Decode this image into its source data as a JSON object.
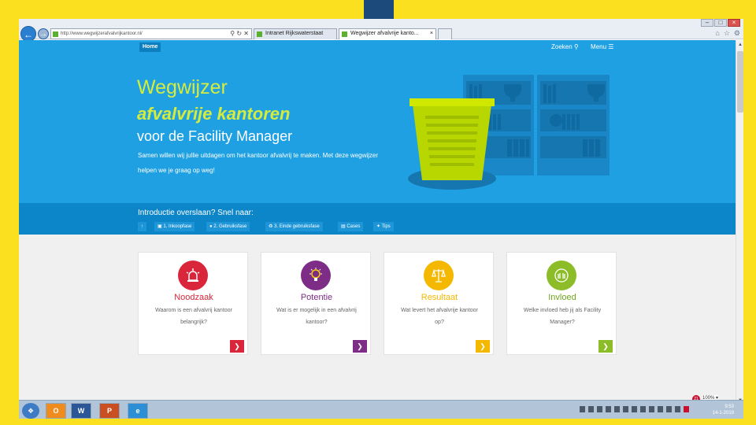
{
  "browser": {
    "address": "http://www.wegwijzerafvalvrijkantoor.nl/",
    "tabs": [
      {
        "label": "Intranet Rijkswaterstaat"
      },
      {
        "label": "Wegwijzer afvalvrije kanto..."
      }
    ],
    "window_controls": [
      "–",
      "□",
      "×"
    ],
    "zoom_label": "100%"
  },
  "site": {
    "nav": {
      "home": "Home",
      "search": "Zoeken",
      "menu": "Menu"
    },
    "hero": {
      "title_line1": "Wegwijzer",
      "title_line2": "afvalvrije kantoren",
      "title_line3": "voor de Facility Manager",
      "description": "Samen willen wij jullie uitdagen om het kantoor afvalvrij te maken. Met deze wegwijzer helpen we je graag op weg!"
    },
    "quickbar": {
      "question": "Introductie overslaan? Snel naar:",
      "links": [
        {
          "label": "1. Inkoopfase"
        },
        {
          "label": "2. Gebruiksfase"
        },
        {
          "label": "3. Einde gebruiksfase"
        },
        {
          "label": "Cases"
        },
        {
          "label": "Tips"
        }
      ]
    },
    "cards": [
      {
        "title": "Noodzaak",
        "description": "Waarom is een afvalvrij kantoor belangrijk?",
        "color": "#d9263a",
        "icon": "siren-icon"
      },
      {
        "title": "Potentie",
        "description": "Wat is er mogelijk in een afvalvrij kantoor?",
        "color": "#7e2d86",
        "icon": "lightbulb-icon"
      },
      {
        "title": "Resultaat",
        "description": "Wat levert het afvalvrije kantoor op?",
        "color": "#f5b800",
        "icon": "scales-icon"
      },
      {
        "title": "Invloed",
        "description": "Welke invloed heb jij als Facility Manager?",
        "color": "#8cbd28",
        "icon": "hands-icon"
      }
    ]
  },
  "taskbar": {
    "apps": [
      "O",
      "W",
      "P",
      "e"
    ],
    "time": "9:53",
    "date": "14-1-2019",
    "notification_count": "21"
  },
  "colors": {
    "hero": "#1fa0e3",
    "accent_green": "#d6ec3c",
    "frame": "#fae01e"
  }
}
